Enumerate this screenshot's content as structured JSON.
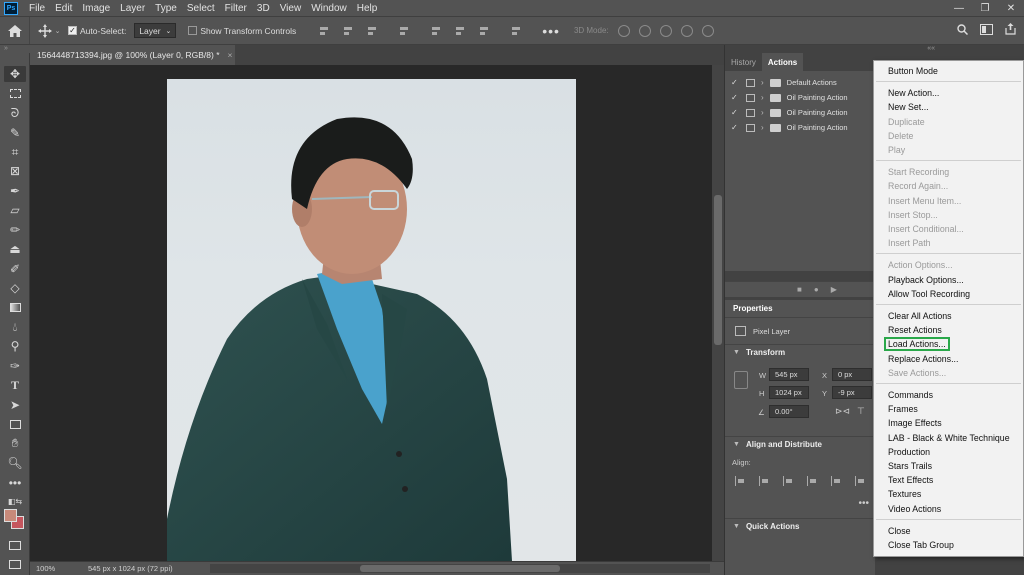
{
  "menubar": {
    "logo": "Ps",
    "items": [
      "File",
      "Edit",
      "Image",
      "Layer",
      "Type",
      "Select",
      "Filter",
      "3D",
      "View",
      "Window",
      "Help"
    ],
    "window_controls": [
      "—",
      "❐",
      "✕"
    ]
  },
  "options": {
    "auto_select_label": "Auto-Select:",
    "auto_select_checked": true,
    "auto_select_target": "Layer",
    "show_transform_label": "Show Transform Controls",
    "show_transform_checked": false,
    "more": "•••",
    "mode_3d_label": "3D Mode:"
  },
  "document": {
    "tab_title": "1564448713394.jpg @ 100% (Layer 0, RGB/8) *",
    "close": "×"
  },
  "status": {
    "zoom": "100%",
    "doc_info": "545 px x 1024 px (72 ppi)",
    "arrow": "›"
  },
  "panels": {
    "tabs": [
      "History",
      "Actions"
    ],
    "active_tab": "Actions",
    "actions": [
      {
        "name": "Default Actions"
      },
      {
        "name": "Oil Painting Action"
      },
      {
        "name": "Oil Painting Action"
      },
      {
        "name": "Oil Painting Action"
      }
    ],
    "properties": {
      "tab": "Properties",
      "layer_type": "Pixel Layer",
      "transform_title": "Transform",
      "w_label": "W",
      "w_value": "545 px",
      "h_label": "H",
      "h_value": "1024 px",
      "x_label": "X",
      "x_value": "0 px",
      "y_label": "Y",
      "y_value": "-9 px",
      "angle_value": "0.00°",
      "align_title": "Align and Distribute",
      "align_label": "Align:",
      "quick_title": "Quick Actions"
    }
  },
  "context_menu": {
    "items": [
      {
        "label": "Button Mode",
        "enabled": true
      },
      {
        "sep": true
      },
      {
        "label": "New Action...",
        "enabled": true
      },
      {
        "label": "New Set...",
        "enabled": true
      },
      {
        "label": "Duplicate",
        "enabled": false
      },
      {
        "label": "Delete",
        "enabled": false
      },
      {
        "label": "Play",
        "enabled": false
      },
      {
        "sep": true
      },
      {
        "label": "Start Recording",
        "enabled": false
      },
      {
        "label": "Record Again...",
        "enabled": false
      },
      {
        "label": "Insert Menu Item...",
        "enabled": false
      },
      {
        "label": "Insert Stop...",
        "enabled": false
      },
      {
        "label": "Insert Conditional...",
        "enabled": false
      },
      {
        "label": "Insert Path",
        "enabled": false
      },
      {
        "sep": true
      },
      {
        "label": "Action Options...",
        "enabled": false
      },
      {
        "label": "Playback Options...",
        "enabled": true
      },
      {
        "label": "Allow Tool Recording",
        "enabled": true
      },
      {
        "sep": true
      },
      {
        "label": "Clear All Actions",
        "enabled": true
      },
      {
        "label": "Reset Actions",
        "enabled": true
      },
      {
        "label": "Load Actions...",
        "enabled": true,
        "highlight": true
      },
      {
        "label": "Replace Actions...",
        "enabled": true
      },
      {
        "label": "Save Actions...",
        "enabled": false
      },
      {
        "sep": true
      },
      {
        "label": "Commands",
        "enabled": true
      },
      {
        "label": "Frames",
        "enabled": true
      },
      {
        "label": "Image Effects",
        "enabled": true
      },
      {
        "label": "LAB - Black & White Technique",
        "enabled": true
      },
      {
        "label": "Production",
        "enabled": true
      },
      {
        "label": "Stars Trails",
        "enabled": true
      },
      {
        "label": "Text Effects",
        "enabled": true
      },
      {
        "label": "Textures",
        "enabled": true
      },
      {
        "label": "Video Actions",
        "enabled": true
      },
      {
        "sep": true
      },
      {
        "label": "Close",
        "enabled": true
      },
      {
        "label": "Close Tab Group",
        "enabled": true
      }
    ]
  },
  "colors": {
    "foreground": "#c88a7a",
    "background": "#c5565e",
    "highlight_border": "#2aa84a"
  }
}
